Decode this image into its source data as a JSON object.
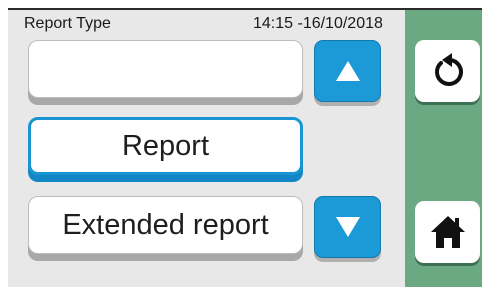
{
  "header": {
    "title": "Report Type",
    "clock": "14:15 -16/10/2018"
  },
  "list": {
    "items": [
      {
        "label": "",
        "selected": false
      },
      {
        "label": "Report",
        "selected": true
      },
      {
        "label": "Extended report",
        "selected": false
      }
    ]
  },
  "nav": {
    "up_icon": "arrow-up-icon",
    "down_icon": "arrow-down-icon",
    "back_icon": "undo-icon",
    "home_icon": "home-icon"
  },
  "colors": {
    "accent": "#1c9ad8",
    "sidebar": "#6ba982",
    "background": "#e8e8e8"
  }
}
